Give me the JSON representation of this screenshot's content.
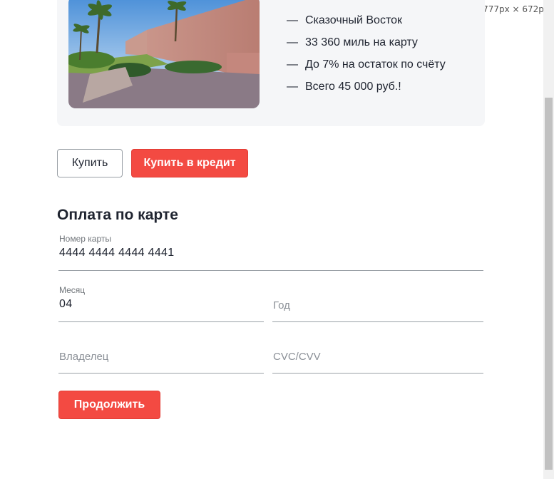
{
  "viewport_size": "777px × 672px",
  "offer": {
    "features": [
      "Сказочный Восток",
      "33 360 миль на карту",
      "До 7% на остаток по счёту",
      "Всего 45 000 руб.!"
    ],
    "dash": "—"
  },
  "actions": {
    "buy_label": "Купить",
    "credit_label": "Купить в кредит"
  },
  "payment": {
    "title": "Оплата по карте",
    "card_number": {
      "label": "Номер карты",
      "value": "4444 4444 4444 4441"
    },
    "month": {
      "label": "Месяц",
      "value": "04"
    },
    "year": {
      "placeholder": "Год"
    },
    "owner": {
      "placeholder": "Владелец"
    },
    "cvc": {
      "placeholder": "CVC/CVV"
    },
    "continue_label": "Продолжить"
  },
  "colors": {
    "accent": "#f34a42",
    "card_bg": "#f5f6f8",
    "text": "#1f2430"
  }
}
